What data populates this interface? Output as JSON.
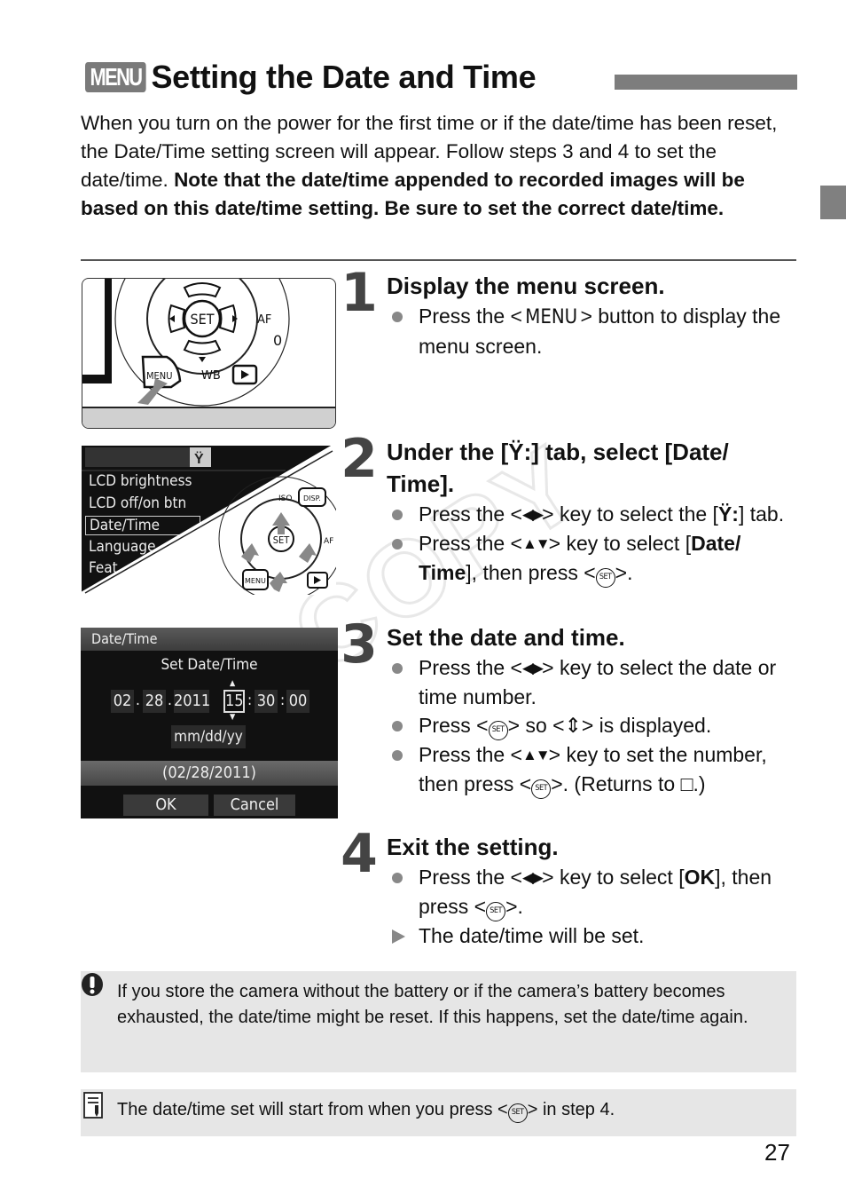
{
  "header": {
    "menu_badge": "MENU",
    "title": "Setting the Date and Time"
  },
  "intro": {
    "plain": "When you turn on the power for the first time or if the date/time has been reset, the Date/Time setting screen will appear. Follow steps 3 and 4 to set the date/time. ",
    "bold": "Note that the date/time appended to recorded images will be based on this date/time setting. Be sure to set the correct date/time."
  },
  "figures": {
    "fig1": {
      "labels": {
        "set": "SET",
        "af": "AF",
        "wb": "WB",
        "menu": "MENU"
      }
    },
    "fig2": {
      "menu_items": [
        "LCD brightness",
        "LCD off/on btn",
        "Date/Time",
        "Language",
        "Feat"
      ],
      "selected_item": "Date/Time",
      "labels": {
        "iso": "ISO",
        "disp": "DISP.",
        "set": "SET",
        "af": "AF",
        "menu": "MENU"
      }
    },
    "fig3": {
      "screen_title": "Date/Time",
      "heading": "Set Date/Time",
      "month": "02",
      "day": "28",
      "year": "2011",
      "hour": "15",
      "minute": "30",
      "second": "00",
      "format": "mm/dd/yy",
      "preview": "(02/28/2011)",
      "ok_label": "OK",
      "cancel_label": "Cancel"
    }
  },
  "steps": [
    {
      "number": "1",
      "heading": "Display the menu screen.",
      "bullets": [
        {
          "type": "dot",
          "pre": "Press the <",
          "menu": "MENU",
          "post": "> button to display the menu screen."
        }
      ]
    },
    {
      "number": "2",
      "heading_pre": "Under the [",
      "heading_icon": "Ÿ:",
      "heading_post": "] tab, select [Date/ Time].",
      "bullets": [
        {
          "type": "dot",
          "pre": "Press the <",
          "arrows": "◀▶",
          "post": "> key to select the [",
          "icon": "Ÿ:",
          "post2": "] tab."
        },
        {
          "type": "dot",
          "pre": "Press the <",
          "arrows": "▲▼",
          "post": "> key to select [",
          "bold": "Date/ Time",
          "post2": "], then press <",
          "set": "SET",
          "post3": ">."
        }
      ]
    },
    {
      "number": "3",
      "heading": "Set the date and time.",
      "bullets": [
        {
          "type": "dot",
          "pre": "Press the <",
          "arrows": "◀▶",
          "post": "> key to select the date or time number."
        },
        {
          "type": "dot",
          "pre": "Press <",
          "set": "SET",
          "post": "> so <",
          "updown": "⇕",
          "post2": "> is displayed."
        },
        {
          "type": "dot",
          "pre": "Press the <",
          "arrows": "▲▼",
          "post": "> key to set the number, then press <",
          "set": "SET",
          "post2": ">. (Returns to ",
          "box": "□",
          "post3": ".)"
        }
      ]
    },
    {
      "number": "4",
      "heading": "Exit the setting.",
      "bullets": [
        {
          "type": "dot",
          "pre": "Press the <",
          "arrows": "◀▶",
          "post": "> key to select [",
          "bold": "OK",
          "post2": "], then press <",
          "set": "SET",
          "post3": ">."
        },
        {
          "type": "triangle",
          "text": "The date/time will be set."
        }
      ]
    }
  ],
  "warning": {
    "text": "If you store the camera without the battery or if the camera’s battery becomes exhausted, the date/time might be reset. If this happens, set the date/time again."
  },
  "note": {
    "pre": "The date/time set will start from when you press <",
    "set": "SET",
    "post": "> in step 4."
  },
  "watermark": "COPY",
  "page_number": "27"
}
